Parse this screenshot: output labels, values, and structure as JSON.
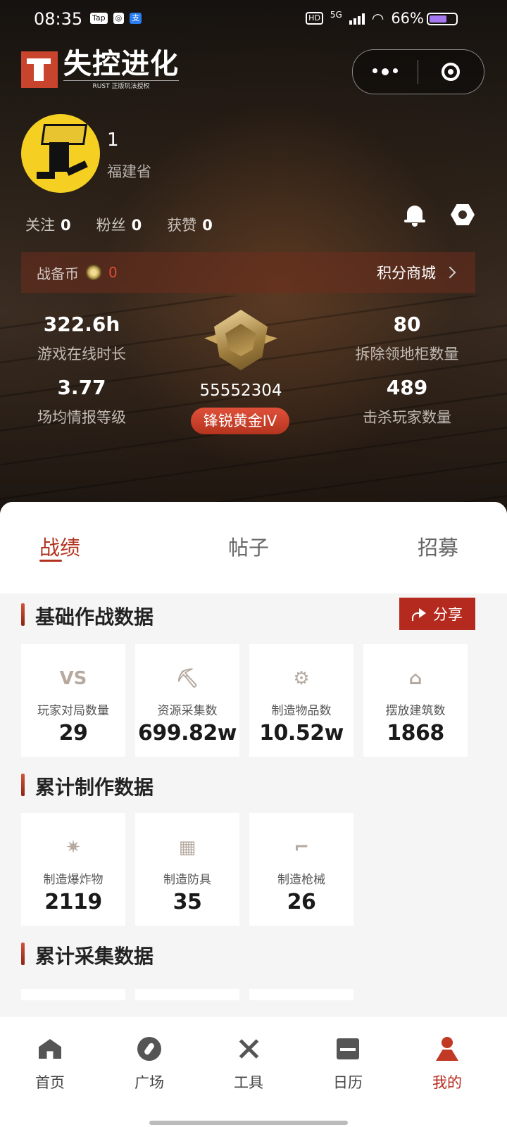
{
  "status_bar": {
    "time": "08:35",
    "apps": [
      "Tap",
      "◎",
      "支"
    ],
    "hd": "HD",
    "network": "5G",
    "battery": "66%",
    "battery_level": 0.66
  },
  "header": {
    "logo_title": "失控进化",
    "logo_subtitle": "RUST 正版玩法授权"
  },
  "profile": {
    "name": "1",
    "region": "福建省",
    "follow_label": "关注",
    "follow_count": "0",
    "fans_label": "粉丝",
    "fans_count": "0",
    "likes_label": "获赞",
    "likes_count": "0"
  },
  "coins": {
    "label": "战备币",
    "value": "0",
    "shop_label": "积分商城"
  },
  "stats": {
    "online_hours": "322.6h",
    "online_hours_label": "游戏在线时长",
    "cabinet_count": "80",
    "cabinet_label": "拆除领地柜数量",
    "intel_level": "3.77",
    "intel_label": "场均情报等级",
    "kills": "489",
    "kills_label": "击杀玩家数量",
    "player_id": "55552304",
    "rank": "锋锐黄金IV"
  },
  "tabs": [
    "战绩",
    "帖子",
    "招募"
  ],
  "sections": {
    "basic_title": "基础作战数据",
    "share_label": "分享",
    "basic_cards": [
      {
        "icon": "vs-icon",
        "icon_text": "VS",
        "label": "玩家对局数量",
        "value": "29"
      },
      {
        "icon": "pickaxe-icon",
        "label": "资源采集数",
        "value": "699.82w"
      },
      {
        "icon": "workbench-icon",
        "label": "制造物品数",
        "value": "10.52w"
      },
      {
        "icon": "house-icon",
        "label": "摆放建筑数",
        "value": "1868"
      }
    ],
    "craft_title": "累计制作数据",
    "craft_cards": [
      {
        "icon": "explosive-icon",
        "label": "制造爆炸物",
        "value": "2119"
      },
      {
        "icon": "armor-icon",
        "label": "制造防具",
        "value": "35"
      },
      {
        "icon": "rifle-icon",
        "label": "制造枪械",
        "value": "26"
      }
    ],
    "gather_title": "累计采集数据"
  },
  "bottom_nav": [
    {
      "label": "首页",
      "icon": "home-icon"
    },
    {
      "label": "广场",
      "icon": "compass-icon"
    },
    {
      "label": "工具",
      "icon": "tools-icon"
    },
    {
      "label": "日历",
      "icon": "calendar-icon"
    },
    {
      "label": "我的",
      "icon": "user-icon",
      "active": true
    }
  ],
  "colors": {
    "accent": "#b52a1e",
    "coin_value": "#e24b37"
  }
}
